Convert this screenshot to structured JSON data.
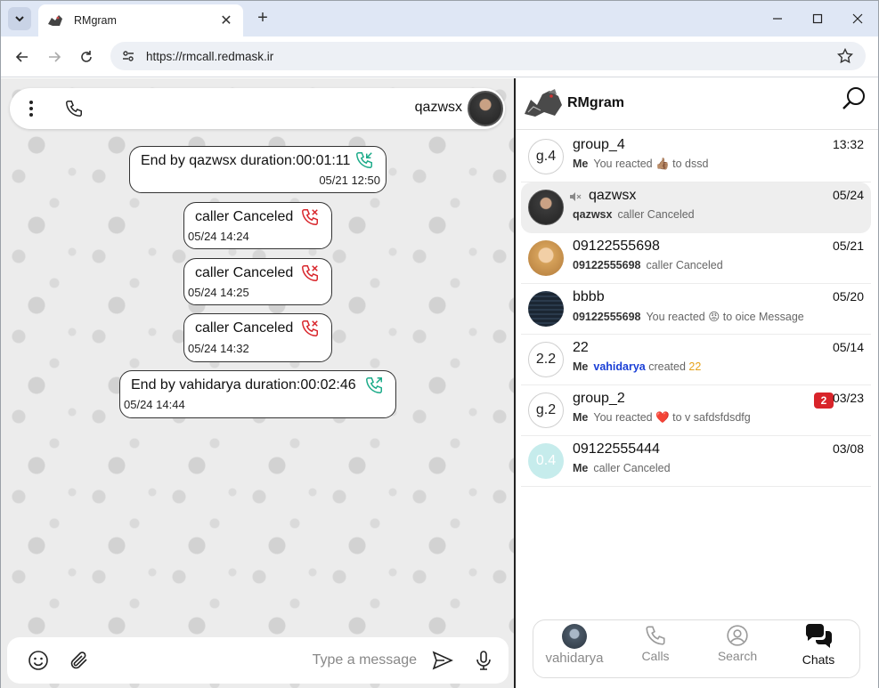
{
  "browser": {
    "tab_title": "RMgram",
    "url": "https://rmcall.redmask.ir"
  },
  "chat": {
    "peer_name": "qazwsx",
    "messages": [
      {
        "text": "End by qazwsx duration:00:01:11",
        "time": "05/21 12:50",
        "icon": "incoming-call-icon",
        "color": "#1aaa88"
      },
      {
        "text": "caller Canceled",
        "time": "05/24 14:24",
        "icon": "missed-call-icon",
        "color": "#d8242a"
      },
      {
        "text": "caller Canceled",
        "time": "05/24 14:25",
        "icon": "missed-call-icon",
        "color": "#d8242a"
      },
      {
        "text": "caller Canceled",
        "time": "05/24 14:32",
        "icon": "missed-call-icon",
        "color": "#d8242a"
      },
      {
        "text": "End by vahidarya duration:00:02:46",
        "time": "05/24 14:44",
        "icon": "outgoing-call-icon",
        "color": "#1aaa88"
      }
    ],
    "composer_placeholder": "Type a message"
  },
  "sidebar": {
    "brand": "RMgram",
    "chats": [
      {
        "avatar_text": "g.4",
        "title": "group_4",
        "date": "13:32",
        "who": "Me",
        "preview": "You reacted 👍🏽 to dssd"
      },
      {
        "avatar_text": "",
        "title": "qazwsx",
        "date": "05/24",
        "who": "qazwsx",
        "preview": "caller Canceled"
      },
      {
        "avatar_text": "",
        "title": "09122555698",
        "date": "05/21",
        "who": "09122555698",
        "preview": "caller Canceled"
      },
      {
        "avatar_text": "",
        "title": "bbbb",
        "date": "05/20",
        "who": "09122555698",
        "preview": "You reacted 😡 to oice Message"
      },
      {
        "avatar_text": "2.2",
        "title": "22",
        "date": "05/14",
        "who": "Me",
        "preview_user": "vahidarya",
        "preview_mid": "created",
        "preview_tail": "22"
      },
      {
        "avatar_text": "g.2",
        "title": "group_2",
        "date": "03/23",
        "who": "Me",
        "preview": "You reacted ❤️ to v safdsfdsdfg",
        "badge": "2"
      },
      {
        "avatar_text": "0.4",
        "title": "09122555444",
        "date": "03/08",
        "who": "Me",
        "preview": "caller Canceled"
      }
    ],
    "nav": [
      {
        "label": "vahidarya"
      },
      {
        "label": "Calls"
      },
      {
        "label": "Search"
      },
      {
        "label": "Chats"
      }
    ]
  },
  "colors": {
    "missed": "#d8242a",
    "answered": "#1aaa88",
    "link_user": "#1a3fd6",
    "created_tag": "#e6a21a"
  }
}
